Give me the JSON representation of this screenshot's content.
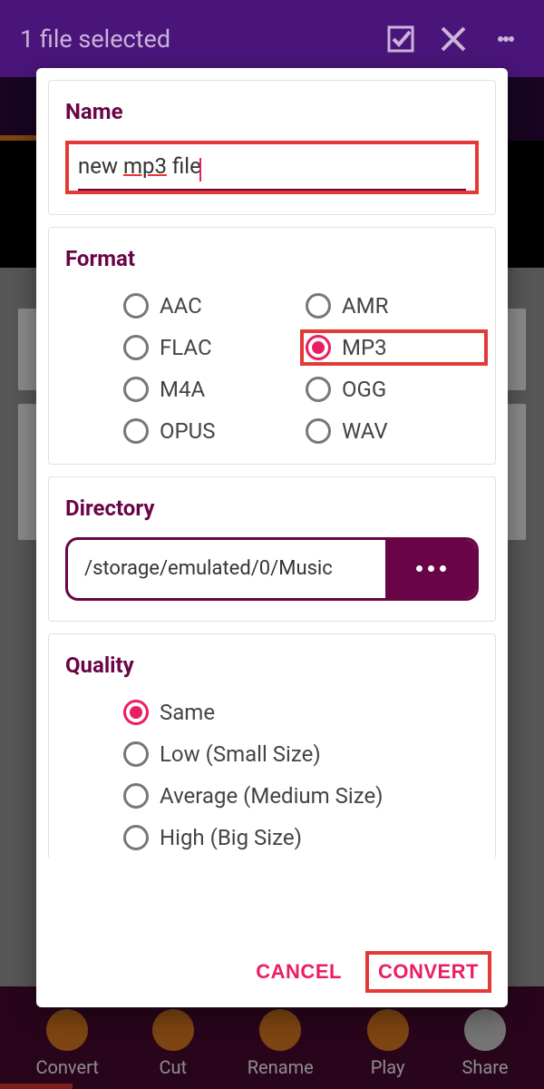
{
  "background": {
    "title": "1 file selected",
    "bottom": [
      "Convert",
      "Cut",
      "Rename",
      "Play",
      "Share"
    ]
  },
  "dialog": {
    "name": {
      "heading": "Name",
      "value": "new mp3 file"
    },
    "format": {
      "heading": "Format",
      "options": [
        "AAC",
        "AMR",
        "FLAC",
        "MP3",
        "M4A",
        "OGG",
        "OPUS",
        "WAV"
      ],
      "selected": "MP3"
    },
    "directory": {
      "heading": "Directory",
      "path": "/storage/emulated/0/Music"
    },
    "quality": {
      "heading": "Quality",
      "options": [
        "Same",
        "Low (Small Size)",
        "Average (Medium Size)",
        "High (Big Size)"
      ],
      "selected": "Same"
    },
    "actions": {
      "cancel": "CANCEL",
      "convert": "CONVERT"
    }
  },
  "colors": {
    "accent": "#690547",
    "highlight": "#e53935",
    "radio_selected": "#e91e63",
    "appbar": "#4a157a"
  },
  "highlights": [
    "name-input",
    "format-option-mp3",
    "convert-button"
  ]
}
